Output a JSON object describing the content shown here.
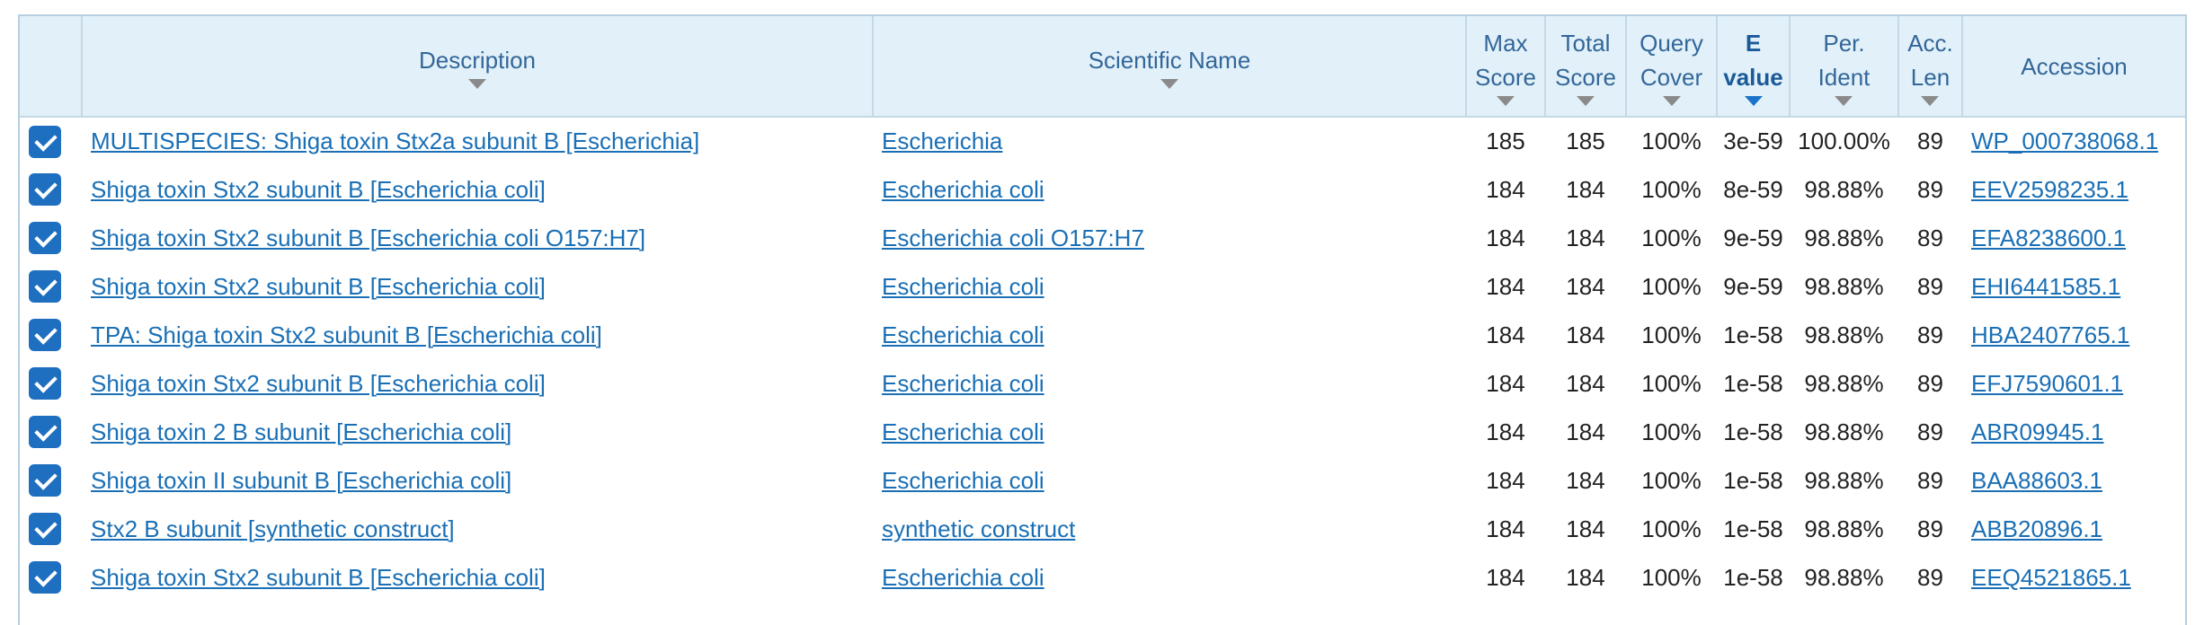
{
  "columns": [
    {
      "l1": "",
      "l2": ""
    },
    {
      "l1": "Description",
      "l2": ""
    },
    {
      "l1": "Scientific Name",
      "l2": ""
    },
    {
      "l1": "Max",
      "l2": "Score"
    },
    {
      "l1": "Total",
      "l2": "Score"
    },
    {
      "l1": "Query",
      "l2": "Cover"
    },
    {
      "l1": "E",
      "l2": "value"
    },
    {
      "l1": "Per.",
      "l2": "Ident"
    },
    {
      "l1": "Acc.",
      "l2": "Len"
    },
    {
      "l1": "Accession",
      "l2": ""
    }
  ],
  "rows": [
    {
      "description": "MULTISPECIES: Shiga toxin Stx2a subunit B [Escherichia]",
      "scientific_name": "Escherichia",
      "max_score": "185",
      "total_score": "185",
      "query_cover": "100%",
      "e_value": "3e-59",
      "per_ident": "100.00%",
      "acc_len": "89",
      "accession": "WP_000738068.1"
    },
    {
      "description": "Shiga toxin Stx2 subunit B [Escherichia coli]",
      "scientific_name": "Escherichia coli",
      "max_score": "184",
      "total_score": "184",
      "query_cover": "100%",
      "e_value": "8e-59",
      "per_ident": "98.88%",
      "acc_len": "89",
      "accession": "EEV2598235.1"
    },
    {
      "description": "Shiga toxin Stx2 subunit B [Escherichia coli O157:H7]",
      "scientific_name": "Escherichia coli O157:H7",
      "max_score": "184",
      "total_score": "184",
      "query_cover": "100%",
      "e_value": "9e-59",
      "per_ident": "98.88%",
      "acc_len": "89",
      "accession": "EFA8238600.1"
    },
    {
      "description": "Shiga toxin Stx2 subunit B [Escherichia coli]",
      "scientific_name": "Escherichia coli",
      "max_score": "184",
      "total_score": "184",
      "query_cover": "100%",
      "e_value": "9e-59",
      "per_ident": "98.88%",
      "acc_len": "89",
      "accession": "EHI6441585.1"
    },
    {
      "description": "TPA: Shiga toxin Stx2 subunit B [Escherichia coli]",
      "scientific_name": "Escherichia coli",
      "max_score": "184",
      "total_score": "184",
      "query_cover": "100%",
      "e_value": "1e-58",
      "per_ident": "98.88%",
      "acc_len": "89",
      "accession": "HBA2407765.1"
    },
    {
      "description": "Shiga toxin Stx2 subunit B [Escherichia coli]",
      "scientific_name": "Escherichia coli",
      "max_score": "184",
      "total_score": "184",
      "query_cover": "100%",
      "e_value": "1e-58",
      "per_ident": "98.88%",
      "acc_len": "89",
      "accession": "EFJ7590601.1"
    },
    {
      "description": "Shiga toxin 2 B subunit [Escherichia coli]",
      "scientific_name": "Escherichia coli",
      "max_score": "184",
      "total_score": "184",
      "query_cover": "100%",
      "e_value": "1e-58",
      "per_ident": "98.88%",
      "acc_len": "89",
      "accession": "ABR09945.1"
    },
    {
      "description": "Shiga toxin II subunit B [Escherichia coli]",
      "scientific_name": "Escherichia coli",
      "max_score": "184",
      "total_score": "184",
      "query_cover": "100%",
      "e_value": "1e-58",
      "per_ident": "98.88%",
      "acc_len": "89",
      "accession": "BAA88603.1"
    },
    {
      "description": "Stx2 B subunit [synthetic construct]",
      "scientific_name": "synthetic construct",
      "max_score": "184",
      "total_score": "184",
      "query_cover": "100%",
      "e_value": "1e-58",
      "per_ident": "98.88%",
      "acc_len": "89",
      "accession": "ABB20896.1"
    },
    {
      "description": "Shiga toxin Stx2 subunit B [Escherichia coli]",
      "scientific_name": "Escherichia coli",
      "max_score": "184",
      "total_score": "184",
      "query_cover": "100%",
      "e_value": "1e-58",
      "per_ident": "98.88%",
      "acc_len": "89",
      "accession": "EEQ4521865.1"
    }
  ],
  "colors": {
    "header_bg": "#e2f1f9",
    "header_text": "#336699",
    "link": "#1a6fb5",
    "checkbox": "#1e6fc0",
    "sort_active": "#1a73c9"
  },
  "sort_icon": "triangle-down-icon",
  "checkbox_icon": "checkmark-icon"
}
